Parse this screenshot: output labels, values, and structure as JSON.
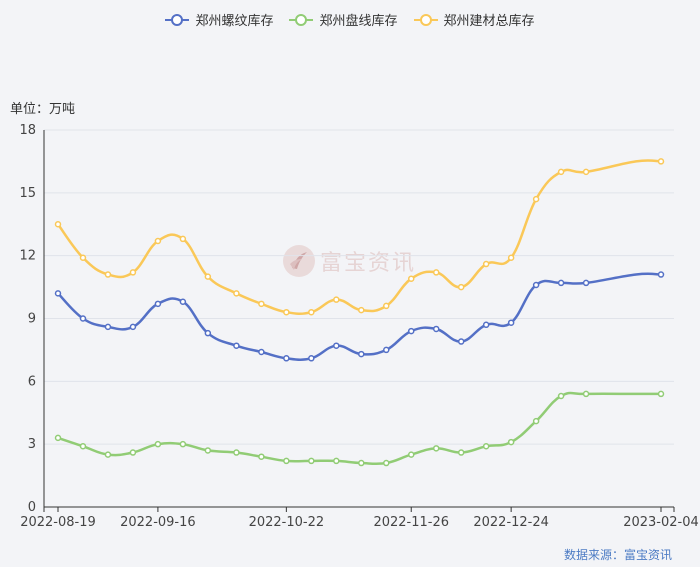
{
  "chart_data": {
    "type": "line",
    "unit_label": "单位：万吨",
    "source": "数据来源：富宝资讯",
    "watermark": "富宝资讯",
    "x_tick_labels": [
      "2022-08-19",
      "2022-09-16",
      "2022-10-22",
      "2022-11-26",
      "2022-12-24",
      "2023-02-04"
    ],
    "x": [
      "2022-08-19",
      "2022-08-26",
      "2022-09-02",
      "2022-09-09",
      "2022-09-16",
      "2022-09-23",
      "2022-09-30",
      "2022-10-08",
      "2022-10-15",
      "2022-10-22",
      "2022-10-29",
      "2022-11-05",
      "2022-11-12",
      "2022-11-19",
      "2022-11-26",
      "2022-12-03",
      "2022-12-10",
      "2022-12-17",
      "2022-12-24",
      "2022-12-31",
      "2023-01-07",
      "2023-01-14",
      "2023-01-28",
      "2023-02-04"
    ],
    "ylim": [
      0,
      18
    ],
    "yticks": [
      0,
      3,
      6,
      9,
      12,
      15,
      18
    ],
    "grid": true,
    "legend_position": "top-center",
    "series": [
      {
        "name": "郑州螺纹库存",
        "color": "#5470c6",
        "values": [
          10.2,
          9.0,
          8.6,
          8.6,
          9.7,
          9.8,
          8.3,
          7.7,
          7.4,
          7.1,
          7.1,
          7.7,
          7.3,
          7.5,
          8.4,
          8.5,
          7.9,
          8.7,
          8.8,
          10.6,
          10.7,
          10.7,
          11.1,
          11.1
        ]
      },
      {
        "name": "郑州盘线库存",
        "color": "#91cc75",
        "values": [
          3.3,
          2.9,
          2.5,
          2.6,
          3.0,
          3.0,
          2.7,
          2.6,
          2.4,
          2.2,
          2.2,
          2.2,
          2.1,
          2.1,
          2.5,
          2.8,
          2.6,
          2.9,
          3.1,
          4.1,
          5.3,
          5.4,
          5.4,
          5.4
        ]
      },
      {
        "name": "郑州建材总库存",
        "color": "#fac858",
        "values": [
          13.5,
          11.9,
          11.1,
          11.2,
          12.7,
          12.8,
          11.0,
          10.2,
          9.7,
          9.3,
          9.3,
          9.9,
          9.4,
          9.6,
          10.9,
          11.2,
          10.5,
          11.6,
          11.9,
          14.7,
          16.0,
          16.0,
          16.5,
          16.5
        ]
      }
    ]
  }
}
